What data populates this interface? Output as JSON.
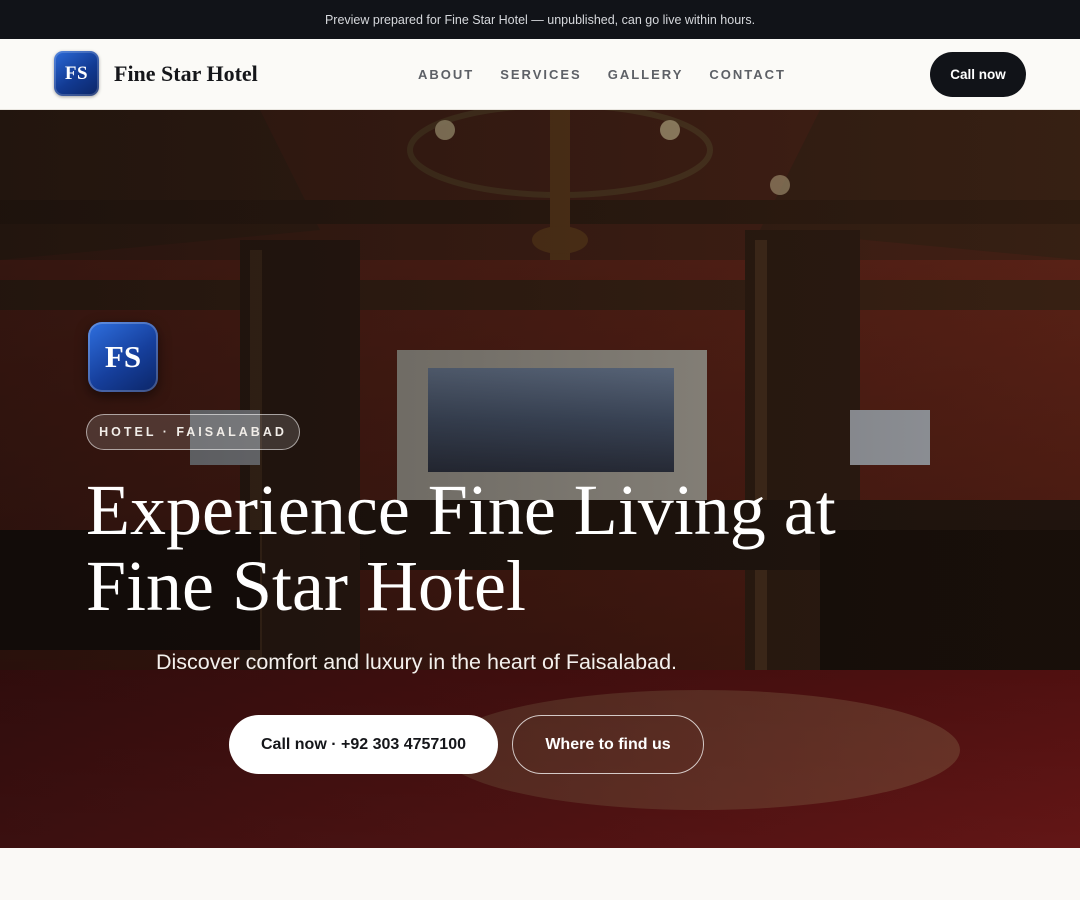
{
  "announcement": "Preview prepared for Fine Star Hotel — unpublished, can go live within hours.",
  "brand": {
    "logo_text": "FS",
    "name": "Fine Star Hotel"
  },
  "nav": {
    "items": [
      {
        "label": "ABOUT"
      },
      {
        "label": "SERVICES"
      },
      {
        "label": "GALLERY"
      },
      {
        "label": "CONTACT"
      }
    ],
    "cta": "Call now"
  },
  "hero": {
    "logo_text": "FS",
    "tag": "HOTEL · FAISALABAD",
    "headline": "Experience Fine Living at Fine Star Hotel",
    "subtitle": "Discover comfort and luxury in the heart of Faisalabad.",
    "primary_cta": "Call now · +92 303 4757100",
    "secondary_cta": "Where to find us"
  },
  "colors": {
    "dark": "#111318",
    "accent_blue": "#123a92",
    "hero_tone": "#6b2418"
  }
}
